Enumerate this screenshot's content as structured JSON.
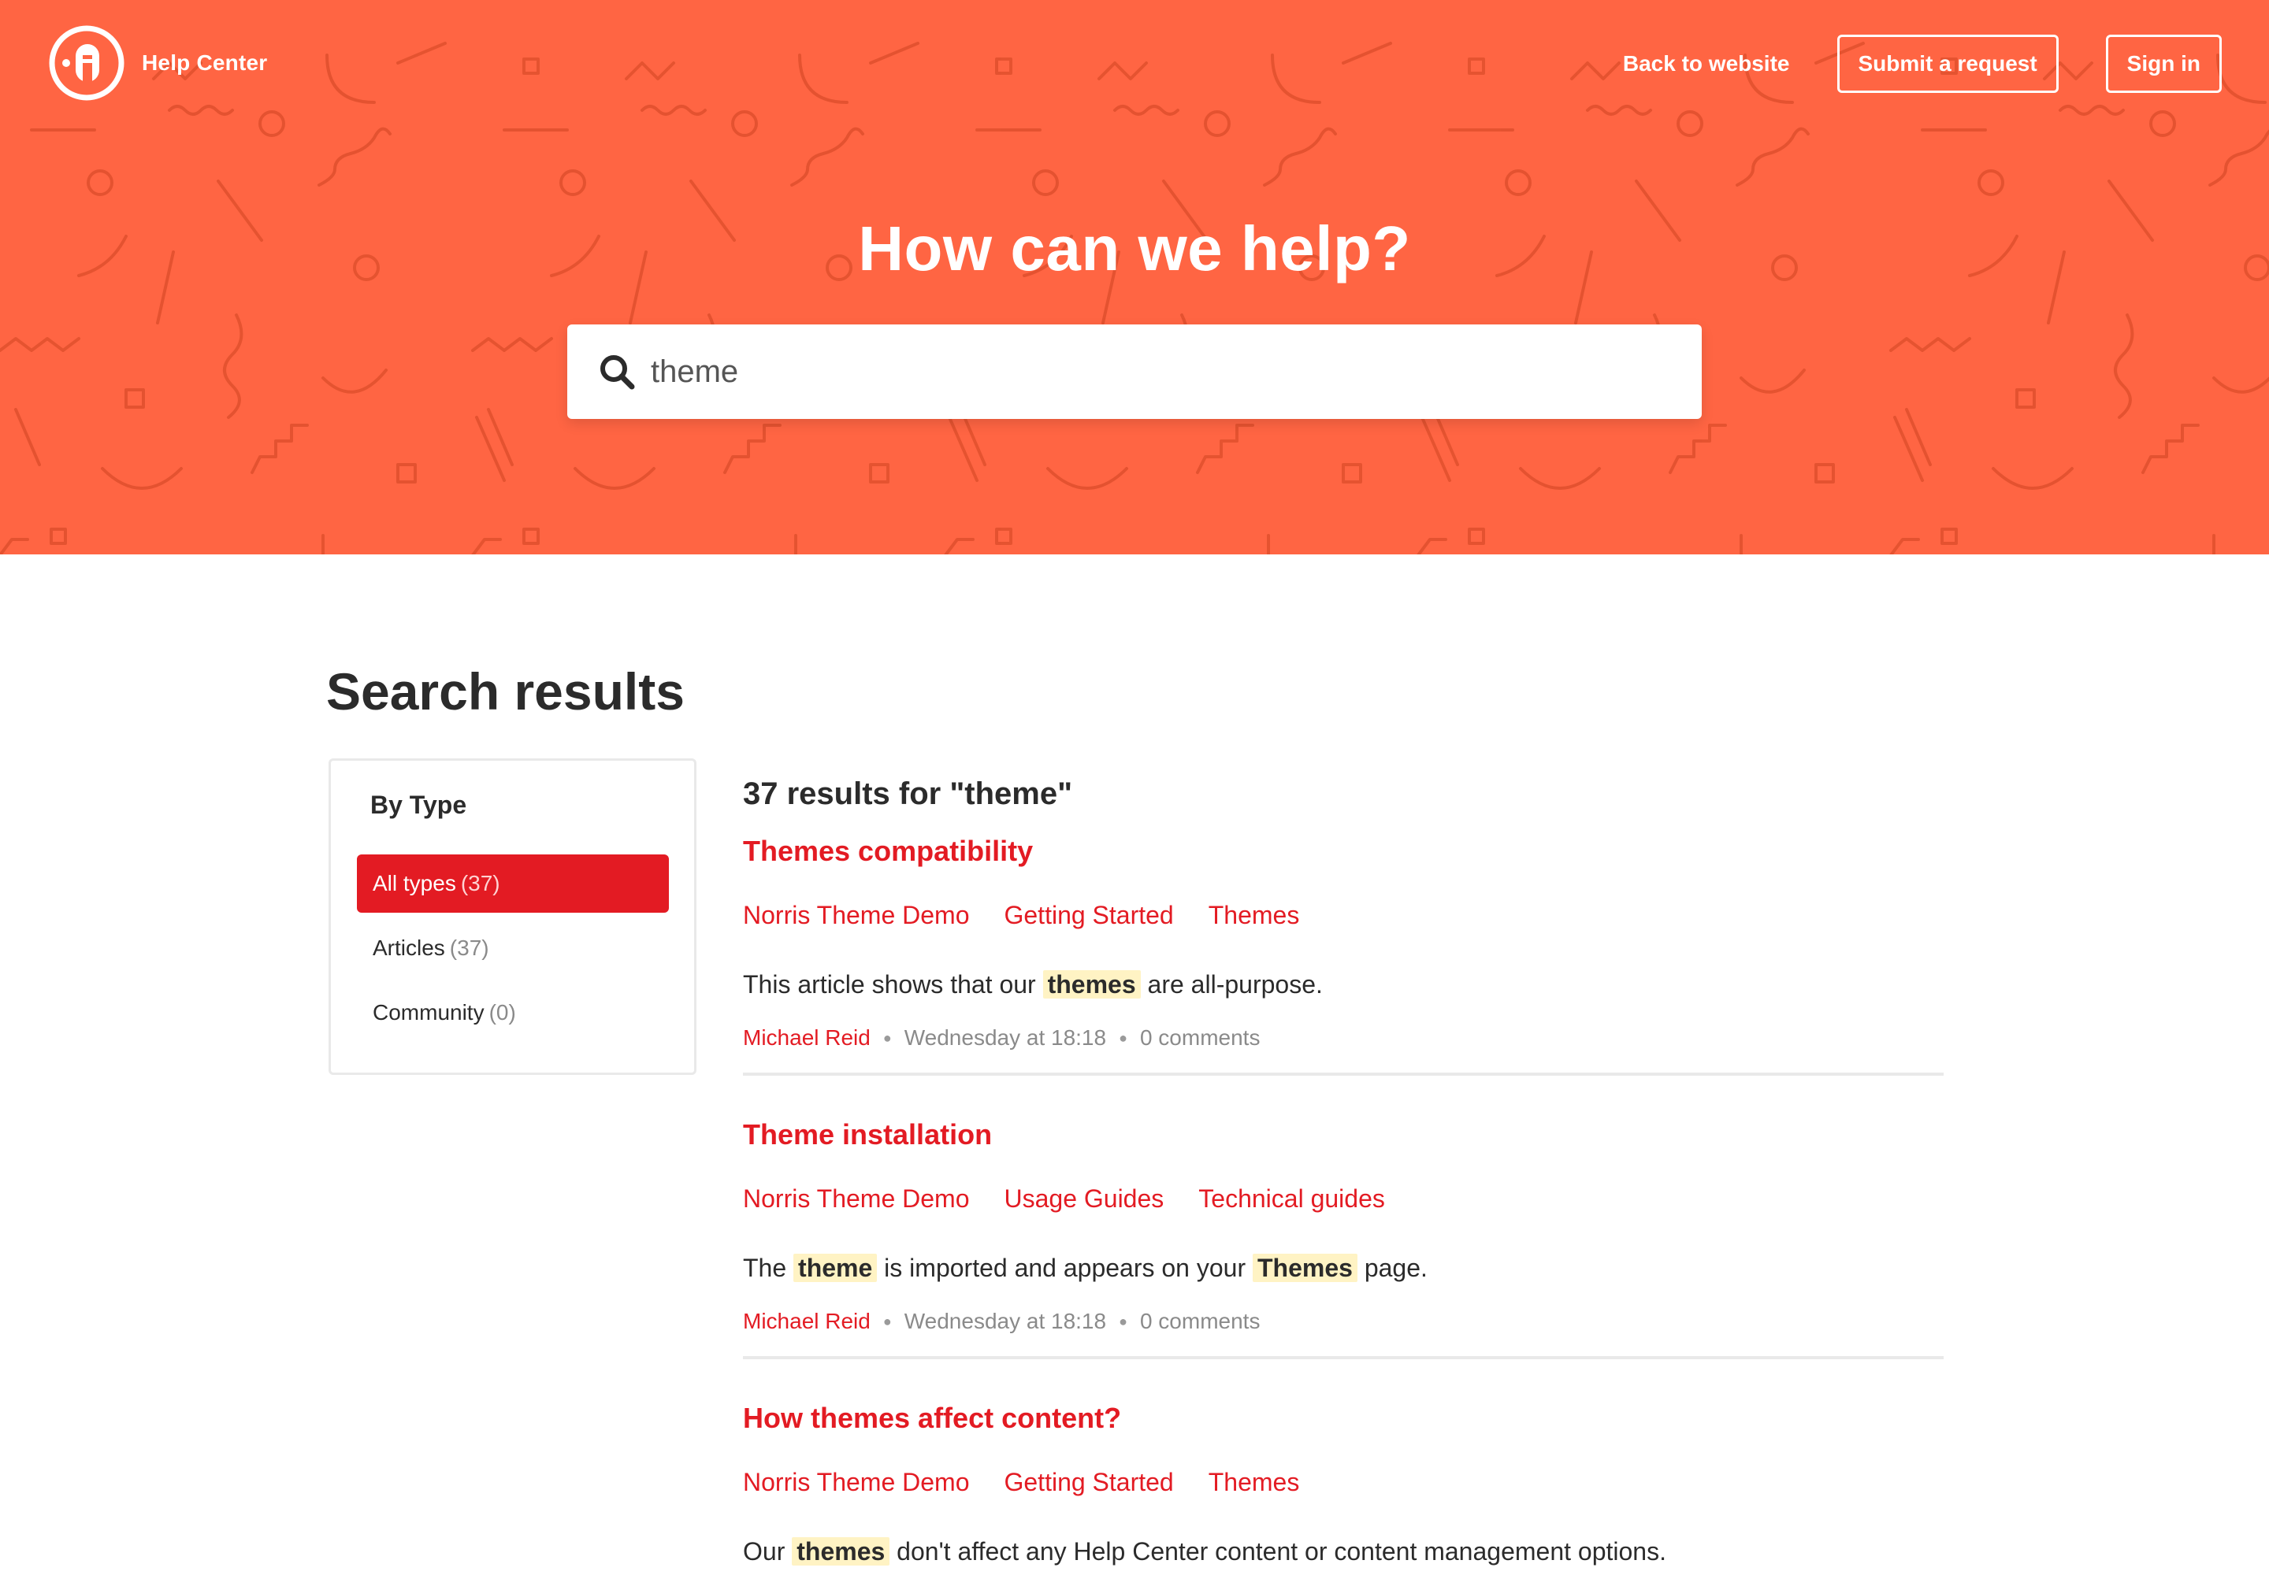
{
  "header": {
    "brand_name": "Help Center",
    "logo_letter": "A",
    "nav": {
      "back_label": "Back to website",
      "request_label": "Submit a request",
      "signin_label": "Sign in"
    }
  },
  "hero": {
    "title": "How can we help?",
    "search": {
      "value": "theme",
      "icon": "search-icon"
    }
  },
  "page_title": "Search results",
  "filters": {
    "heading": "By Type",
    "items": [
      {
        "label": "All types",
        "count": "(37)",
        "active": true
      },
      {
        "label": "Articles",
        "count": "(37)",
        "active": false
      },
      {
        "label": "Community",
        "count": "(0)",
        "active": false
      }
    ]
  },
  "results": {
    "summary": "37 results for \"theme\"",
    "items": [
      {
        "title": "Themes compatibility",
        "breadcrumbs": [
          "Norris Theme Demo",
          "Getting Started",
          "Themes"
        ],
        "excerpt": {
          "before": "This article shows that our ",
          "highlight": "themes",
          "after": " are all-purpose."
        },
        "author": "Michael Reid",
        "date": "Wednesday at 18:18",
        "comments": "0 comments"
      },
      {
        "title": "Theme installation",
        "breadcrumbs": [
          "Norris Theme Demo",
          "Usage Guides",
          "Technical guides"
        ],
        "excerpt": {
          "before": "The ",
          "highlight": "theme",
          "middle": " is imported and appears on your ",
          "highlight2": "Themes",
          "after": " page."
        },
        "author": "Michael Reid",
        "date": "Wednesday at 18:18",
        "comments": "0 comments"
      },
      {
        "title": "How themes affect content?",
        "breadcrumbs": [
          "Norris Theme Demo",
          "Getting Started",
          "Themes"
        ],
        "excerpt": {
          "before": "Our ",
          "highlight": "themes",
          "after": " don't affect any Help Center content or content management options."
        }
      }
    ]
  },
  "colors": {
    "hero_bg": "#ff6543",
    "accent": "#e31b23",
    "highlight_bg": "#fff3c4"
  }
}
